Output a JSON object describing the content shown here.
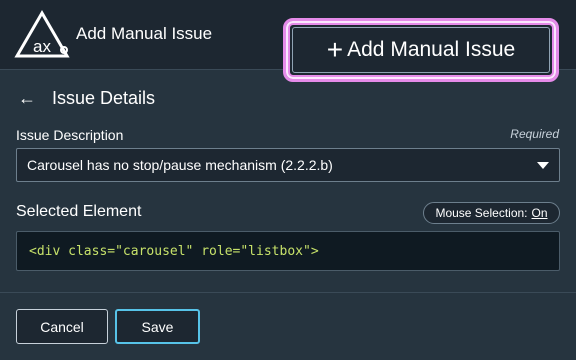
{
  "header": {
    "logo_text": "ax",
    "title": "Add Manual Issue",
    "add_button_label": "Add Manual Issue"
  },
  "section": {
    "title": "Issue Details"
  },
  "issue_description": {
    "label": "Issue Description",
    "required_text": "Required",
    "selected_value": "Carousel has no stop/pause mechanism (2.2.2.b)"
  },
  "selected_element": {
    "label": "Selected Element",
    "mouse_selection_label": "Mouse Selection:",
    "mouse_selection_state": "On",
    "code": {
      "open": "<div",
      "attr1": "class",
      "val1": "\"carousel\"",
      "attr2": "role",
      "val2": "\"listbox\"",
      "close": ">"
    }
  },
  "footer": {
    "cancel_label": "Cancel",
    "save_label": "Save"
  },
  "colors": {
    "background": "#26343f",
    "header": "#1d2731",
    "highlight": "#e58be9",
    "save_border": "#57c3e8",
    "code_text": "#c7e26a"
  },
  "icons": [
    "ax-logo-icon",
    "plus-icon",
    "back-arrow-icon",
    "caret-down-icon"
  ]
}
